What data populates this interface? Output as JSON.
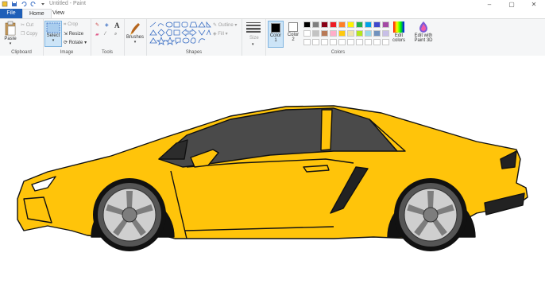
{
  "window": {
    "title": "Untitled - Paint"
  },
  "tabs": {
    "file": "File",
    "home": "Home",
    "view": "View"
  },
  "clipboard": {
    "paste": "Paste",
    "cut": "Cut",
    "copy": "Copy",
    "label": "Clipboard"
  },
  "image": {
    "select": "Select",
    "crop": "Crop",
    "resize": "Resize",
    "rotate": "Rotate",
    "label": "Image"
  },
  "tools": {
    "label": "Tools"
  },
  "brushes": {
    "label": "Brushes"
  },
  "shapes": {
    "outline": "Outline",
    "fill": "Fill",
    "label": "Shapes"
  },
  "size": {
    "label": "Size"
  },
  "colors": {
    "color1": "Color",
    "color1_num": "1",
    "color2": "Color",
    "color2_num": "2",
    "label": "Colors",
    "edit": "Edit",
    "edit2": "colors",
    "paint3d": "Edit with",
    "paint3d2": "Paint 3D",
    "color1_value": "#000000",
    "color2_value": "#ffffff",
    "palette_row1": [
      "#000000",
      "#7f7f7f",
      "#880015",
      "#ed1c24",
      "#ff7f27",
      "#fff200",
      "#22b14c",
      "#00a2e8",
      "#3f48cc",
      "#a349a4"
    ],
    "palette_row2": [
      "#ffffff",
      "#c3c3c3",
      "#b97a57",
      "#ffaec9",
      "#ffc90e",
      "#efe4b0",
      "#b5e61d",
      "#99d9ea",
      "#7092be",
      "#c8bfe7"
    ]
  },
  "drawing": {
    "car_color": "#ffc40a",
    "window_color": "#4a4a4a",
    "wheel_color": "#7d7d7d"
  }
}
